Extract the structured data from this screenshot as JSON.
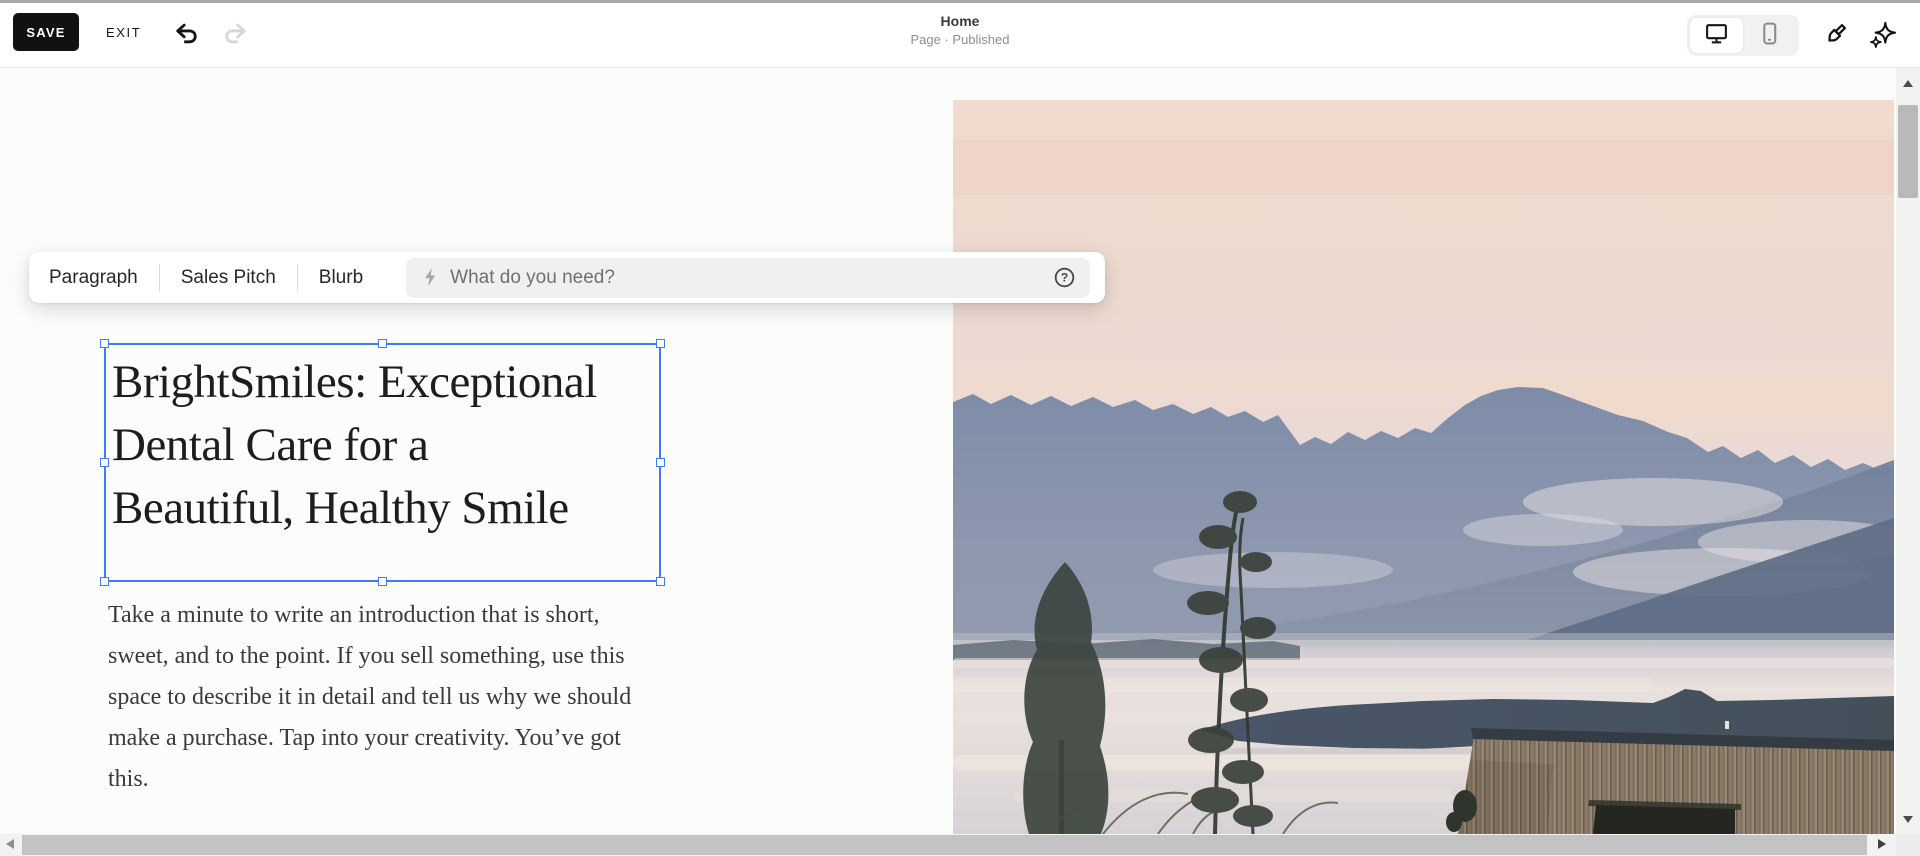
{
  "topbar": {
    "save_label": "SAVE",
    "exit_label": "EXIT",
    "title": "Home",
    "subtitle": "Page · Published",
    "device_toggle": {
      "active": "desktop"
    },
    "icons": {
      "undo": "curved-left-hook-arrow",
      "redo": "curved-right-hook-arrow",
      "desktop": "monitor",
      "mobile": "smartphone",
      "styles": "paintbrush",
      "ai_assistant": "sparkles"
    }
  },
  "ai_toolbar": {
    "tabs": [
      {
        "label": "Paragraph"
      },
      {
        "label": "Sales Pitch"
      },
      {
        "label": "Blurb"
      }
    ],
    "prompt_placeholder": "What do you need?",
    "icons": {
      "prompt": "lightning-bolt",
      "help": "question-mark-circle"
    }
  },
  "page": {
    "heading_lines": [
      "BrightSmiles: Exceptional",
      "Dental Care for a",
      "Beautiful, Healthy Smile"
    ],
    "intro_lines": [
      "Take a minute to write an introduction that is short,",
      "sweet, and to the point. If you sell something, use this",
      "space to describe it in detail and tell us why we should",
      "make a purchase. Tap into your creativity. You’ve got",
      "this."
    ],
    "hero_image": "mountain-lake-dusk-landscape-with-trees-and-wooden-building"
  },
  "colors": {
    "selection_blue": "#3e7bf4",
    "save_button_black": "#111111",
    "sky_peach": "#f1dbce",
    "mountain_blue": "#8090aa",
    "water_light": "#e9e1de",
    "tree_dark": "#3c443e",
    "wood_brown": "#8b7b68"
  }
}
